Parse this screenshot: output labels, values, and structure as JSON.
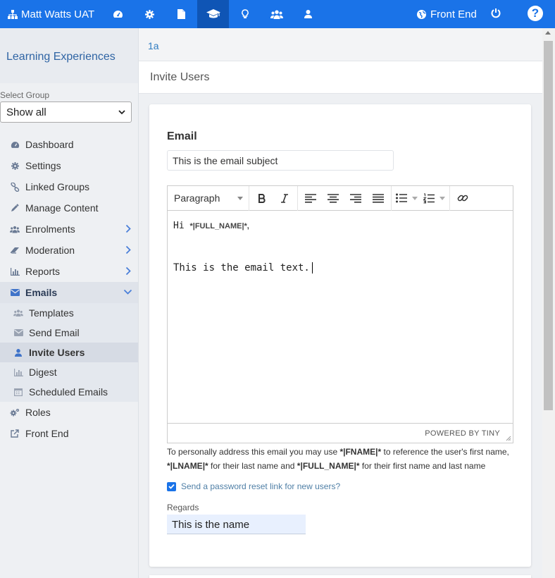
{
  "topbar": {
    "site_name": "Matt Watts UAT",
    "nav_icons": [
      "dashboard-icon",
      "gear-icon",
      "document-icon",
      "graduation-cap-icon",
      "lightbulb-icon",
      "users-icon",
      "user-icon"
    ],
    "front_end": "Front End",
    "help": "?"
  },
  "sidebar": {
    "title": "Learning Experiences",
    "select_label": "Select Group",
    "select_value": "Show all",
    "items": [
      {
        "label": "Dashboard",
        "icon": "dashboard-icon"
      },
      {
        "label": "Settings",
        "icon": "gear-icon"
      },
      {
        "label": "Linked Groups",
        "icon": "link-icon"
      },
      {
        "label": "Manage Content",
        "icon": "pencil-icon"
      },
      {
        "label": "Enrolments",
        "icon": "users-icon"
      },
      {
        "label": "Moderation",
        "icon": "eraser-icon"
      },
      {
        "label": "Reports",
        "icon": "bar-chart-icon"
      },
      {
        "label": "Emails",
        "icon": "envelope-icon"
      },
      {
        "label": "Roles",
        "icon": "cogs-icon"
      },
      {
        "label": "Front End",
        "icon": "external-link-icon"
      }
    ],
    "email_sub": [
      {
        "label": "Templates",
        "icon": "users-icon"
      },
      {
        "label": "Send Email",
        "icon": "envelope-icon"
      },
      {
        "label": "Invite Users",
        "icon": "user-icon"
      },
      {
        "label": "Digest",
        "icon": "bar-chart-icon"
      },
      {
        "label": "Scheduled Emails",
        "icon": "calendar-icon"
      }
    ]
  },
  "main": {
    "breadcrumb": "1a",
    "page_title": "Invite Users",
    "card_title": "Email",
    "subject": "This is the email subject",
    "editor": {
      "format": "Paragraph",
      "greeting": "Hi ",
      "greeting_tag": "*|FULL_NAME|*,",
      "body": "This is the email text.",
      "powered_by": "POWERED BY TINY"
    },
    "help": {
      "t1": "To personally address this email you may use ",
      "fname": "*|FNAME|*",
      "t2": " to reference the user's first name,",
      "lname": "*|LNAME|*",
      "t3": " for their last name and ",
      "fullname": "*|FULL_NAME|*",
      "t4": " for their first name and last name"
    },
    "reset_label": "Send a password reset link for new users?",
    "reset_checked": true,
    "regards_label": "Regards",
    "regards_value": "This is the name"
  },
  "colors": {
    "primary": "#1a73e8",
    "active_nav": "#0f55b5",
    "sidebar_title": "#2f64a4"
  }
}
